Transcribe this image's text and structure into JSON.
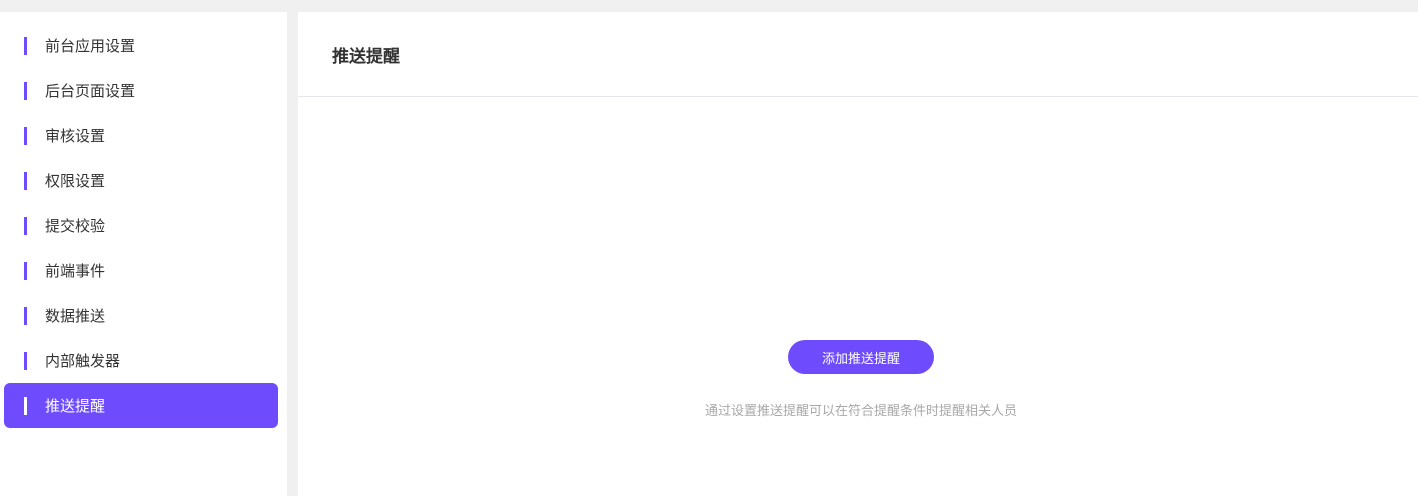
{
  "sidebar": {
    "items": [
      {
        "label": "前台应用设置"
      },
      {
        "label": "后台页面设置"
      },
      {
        "label": "审核设置"
      },
      {
        "label": "权限设置"
      },
      {
        "label": "提交校验"
      },
      {
        "label": "前端事件"
      },
      {
        "label": "数据推送"
      },
      {
        "label": "内部触发器"
      },
      {
        "label": "推送提醒",
        "active": true
      }
    ]
  },
  "main": {
    "title": "推送提醒",
    "add_button": "添加推送提醒",
    "hint": "通过设置推送提醒可以在符合提醒条件时提醒相关人员"
  },
  "colors": {
    "accent": "#6e4bfd"
  }
}
